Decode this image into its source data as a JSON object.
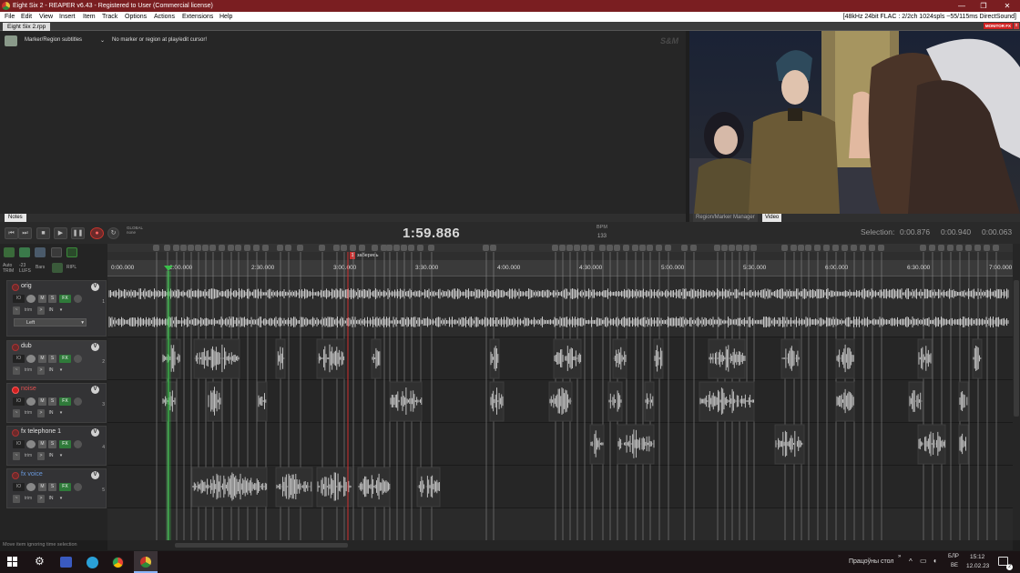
{
  "window": {
    "title": "Eight Six 2 - REAPER v6.43 - Registered to User (Commercial license)",
    "buttons": [
      "—",
      "❐",
      "✕"
    ]
  },
  "menu": {
    "items": [
      "File",
      "Edit",
      "View",
      "Insert",
      "Item",
      "Track",
      "Options",
      "Actions",
      "Extensions",
      "Help"
    ],
    "status": "[48kHz 24bit FLAC : 2/2ch 1024spls ~55/115ms DirectSound]"
  },
  "tabs": {
    "project": "Eight Six 2.rpp",
    "monitor_badge": "MONITOR FX",
    "close": "x"
  },
  "notes": {
    "selector": "Marker/Region subtitles",
    "message": "No marker or region at play/edit cursor!",
    "logo": "S&M",
    "tab": "Notes"
  },
  "video": {
    "tabs": [
      "Region/Marker Manager",
      "Video"
    ]
  },
  "transport": {
    "time": "1:59.886",
    "bpm_label": "BPM",
    "bpm_value": "133",
    "global_label": "GLOBAL",
    "global_value": "none",
    "selection_label": "Selection:",
    "selection_start": "0:00.876",
    "selection_end": "0:00.940",
    "selection_length": "0:00.063"
  },
  "toolbar": {
    "auto_label": "Auto",
    "auto_value": "TRIM",
    "lufs": "-23 LUFS",
    "items_label": "Bars",
    "ripple": "RIPL"
  },
  "tracks": [
    {
      "name": "orig",
      "number": "1",
      "pan": "Left",
      "name_color": "#e0e0e0"
    },
    {
      "name": "dub",
      "number": "2",
      "name_color": "#e0e0e0"
    },
    {
      "name": "noise",
      "number": "3",
      "name_color": "#e05050"
    },
    {
      "name": "fx telephone 1",
      "number": "4",
      "name_color": "#e0e0e0"
    },
    {
      "name": "fx voice",
      "number": "5",
      "name_color": "#6a9ade"
    }
  ],
  "track_buttons": {
    "m": "M",
    "s": "S",
    "fx": "FX",
    "io": "IO",
    "trim": "trim",
    "in": "IN"
  },
  "ruler": {
    "labels": [
      "0:00.000",
      "2:00.000",
      "2:30.000",
      "3:00.000",
      "3:30.000",
      "4:00.000",
      "4:30.000",
      "5:00.000",
      "5:30.000",
      "6:00.000",
      "6:30.000",
      "7:00.000"
    ]
  },
  "marker": {
    "number": "1",
    "label": "заберись"
  },
  "status_text": "Move item ignoring time selection",
  "taskbar": {
    "desktop": "Працоўны стол",
    "lang": "БЛР",
    "lang2": "BE",
    "time": "15:12",
    "date": "12.02.23",
    "notif": "2"
  },
  "colors": {
    "title_bar": "#7a1e21",
    "record_red": "#c8352c",
    "fx_green": "#2f7a3a",
    "playhead_green": "#3bbf4b",
    "edit_cursor_red": "#d03030"
  }
}
